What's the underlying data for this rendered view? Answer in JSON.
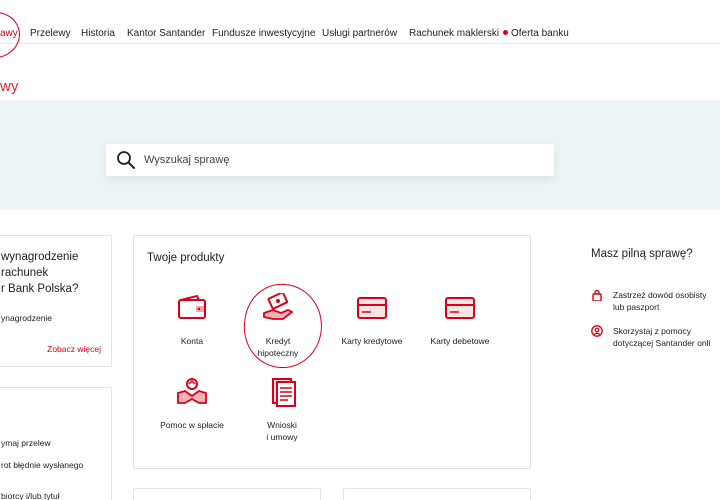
{
  "nav": {
    "active": "awy",
    "items": [
      "Przelewy",
      "Historia",
      "Kantor Santander",
      "Fundusze inwestycyjne",
      "Usługi partnerów",
      "Rachunek maklerski"
    ],
    "offer": "Oferta banku"
  },
  "page": {
    "title": "wy"
  },
  "search": {
    "placeholder": "Wyszukaj sprawę"
  },
  "promo": {
    "title": "wynagrodzenie\nrachunek\nr Bank Polska?",
    "text": "ynagrodzenie",
    "link": "Zobacz więcej"
  },
  "transfers": {
    "line1": "ymaj przelew",
    "line2": "rot błędnie wysłanego",
    "line3": "biorcy i/lub tytuł"
  },
  "products": {
    "title": "Twoje produkty",
    "konta": "Konta",
    "kredyt": "Kredyt\nhipoteczny",
    "karty_kredytowe": "Karty kredytowe",
    "karty_debetowe": "Karty debetowe",
    "pomoc": "Pomoc w spłacie",
    "wnioski": "Wnioski\ni umowy"
  },
  "urgent": {
    "title": "Masz pilną sprawę?",
    "item1": "Zastrzeż dowód osobisty\nlub paszport",
    "item2": "Skorzystaj z pomocy\ndotyczącej Santander onli"
  },
  "colors": {
    "brand_red": "#d9001a",
    "hero_bg": "#edf4f5"
  }
}
